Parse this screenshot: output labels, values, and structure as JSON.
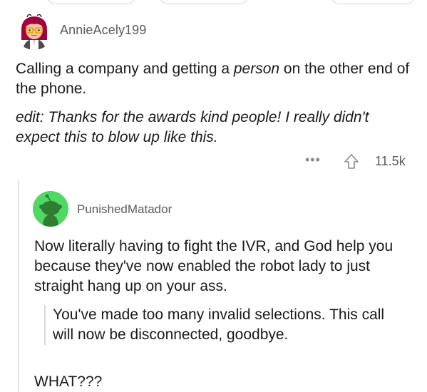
{
  "comment": {
    "author": "AnnieAcely199",
    "text_1": "Calling a company and getting a person on the other end of the phone.",
    "text_2_parts": {
      "before": "Calling a company and getting a ",
      "emph": "person",
      "after": " on the other end of the phone."
    },
    "edit": "edit: Thanks for the awards kind people! I really didn't expect this to blow up like this.",
    "more_icon": "more-icon",
    "upvote_icon": "upvote-icon",
    "votes": "11.5k"
  },
  "reply": {
    "author": "PunishedMatador",
    "text": "Now literally having to fight the IVR, and God help you because they've now enabled the robot lady to just straight hang up on your ass.",
    "quote": "You've made too many invalid selections. This call will now be disconnected, goodbye.",
    "tail": "WHAT???"
  },
  "colors": {
    "reply_avatar_bg": "#4fd864",
    "muted_text": "#5b5b5b",
    "icon_gray": "#878a8c"
  }
}
